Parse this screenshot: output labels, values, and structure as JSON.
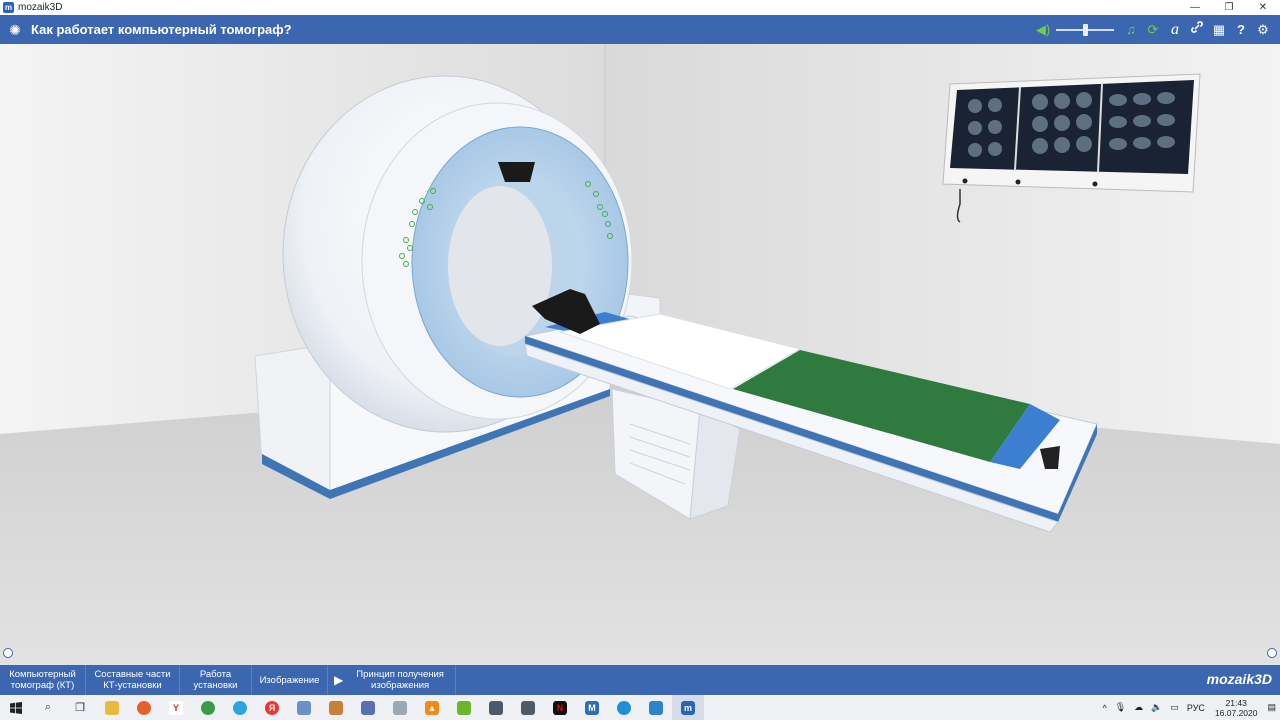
{
  "window": {
    "app_name": "mozaik3D",
    "controls": [
      "—",
      "❐",
      "✕"
    ]
  },
  "header": {
    "title": "Как работает компьютерный томограф?",
    "volume_level": 0.5,
    "tools": [
      {
        "name": "music-icon",
        "glyph": "♫"
      },
      {
        "name": "rotate-icon",
        "glyph": "⟳"
      },
      {
        "name": "font-icon",
        "glyph": "a"
      },
      {
        "name": "link-icon",
        "glyph": "🔗"
      },
      {
        "name": "grid-icon",
        "glyph": "▦"
      },
      {
        "name": "help-icon",
        "glyph": "?"
      },
      {
        "name": "settings-icon",
        "glyph": "⚙"
      }
    ]
  },
  "nav": {
    "tabs": [
      {
        "label": "Компьютерный томограф (КТ)",
        "width": 86
      },
      {
        "label": "Составные части КТ-установки",
        "width": 94
      },
      {
        "label": "Работа установки",
        "width": 72
      },
      {
        "label": "Изображение",
        "width": 76
      },
      {
        "label": "Принцип получения изображения",
        "width": 128,
        "play": true
      }
    ],
    "brand": "mozaik3D"
  },
  "taskbar": {
    "tray_lang": "РУС",
    "time": "21:43",
    "date": "16.07.2020"
  },
  "colors": {
    "accent": "#3d66b0",
    "gantry_blue": "#a9c8e6",
    "sheet_green": "#2f7a3e"
  }
}
